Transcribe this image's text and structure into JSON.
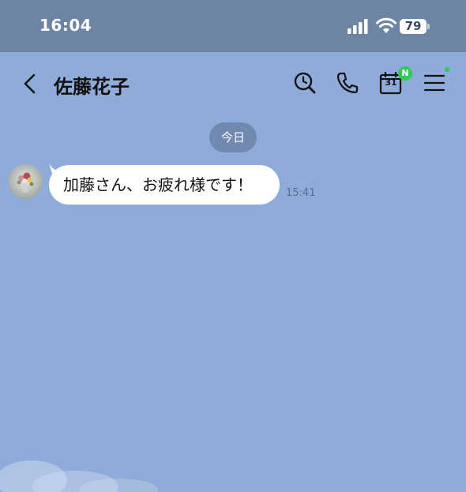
{
  "status_bar": {
    "time": "16:04",
    "battery_level": "79",
    "icons": [
      "signal-icon",
      "wifi-icon",
      "battery-icon"
    ]
  },
  "header": {
    "title": "佐藤花子",
    "calendar_number": "31",
    "calendar_badge": "N",
    "icons": [
      "back-icon",
      "search-icon",
      "phone-icon",
      "calendar-icon",
      "menu-icon"
    ],
    "badge_color": "#34c759"
  },
  "chat": {
    "date_separator": "今日",
    "messages": [
      {
        "text": "加藤さん、お疲れ様です！",
        "time": "15:41"
      }
    ]
  },
  "colors": {
    "background": "#8eabd9",
    "status_bar": "#6e84a5",
    "bubble": "#ffffff"
  }
}
